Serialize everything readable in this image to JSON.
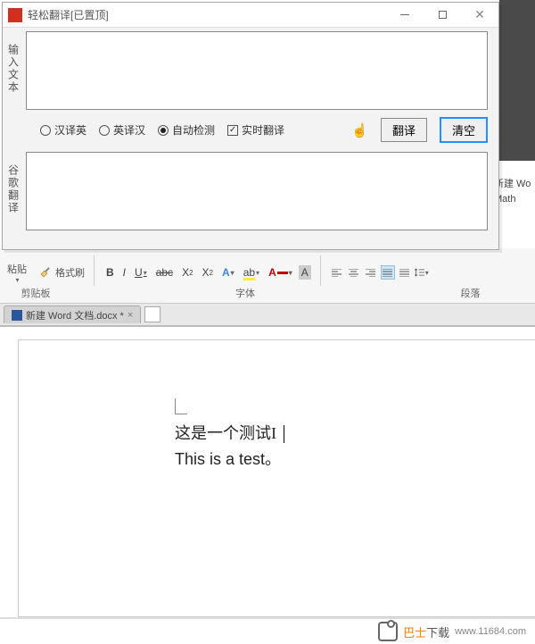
{
  "translator": {
    "title": "轻松翻译[已置顶]",
    "input_label": "输入文本",
    "output_label": "谷歌翻译",
    "options": {
      "cn_to_en": "汉译英",
      "en_to_cn": "英译汉",
      "auto_detect": "自动检测",
      "realtime": "实时翻译"
    },
    "buttons": {
      "translate": "翻译",
      "clear": "清空"
    }
  },
  "word": {
    "paste": "粘贴",
    "format_painter": "格式刷",
    "sections": {
      "clipboard": "剪贴板",
      "font": "字体",
      "paragraph": "段落"
    },
    "right_panel": {
      "new_doc": "新建 Wo",
      "math": "Math"
    },
    "doc_tab": "新建 Word 文档.docx *",
    "content": {
      "line1": "这是一个测试",
      "line2": "This is a test。"
    }
  },
  "footer": {
    "brand": "巴士",
    "suffix": "下载",
    "url": "www.11684.com"
  }
}
